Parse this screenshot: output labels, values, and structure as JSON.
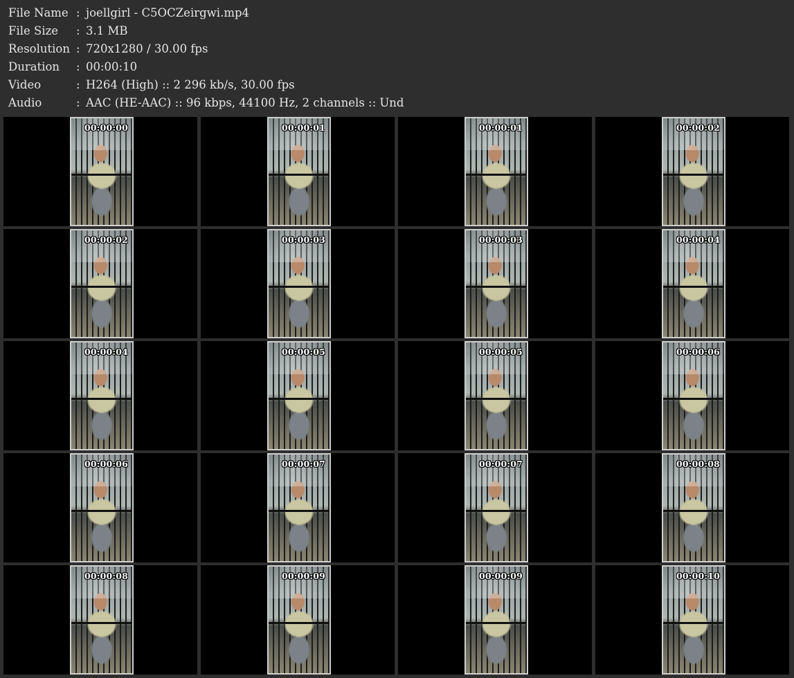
{
  "info": [
    {
      "label": "File Name",
      "sep": ":",
      "value": "joellgirl - C5OCZeirgwi.mp4"
    },
    {
      "label": "File Size",
      "sep": ":",
      "value": "3.1 MB"
    },
    {
      "label": "Resolution",
      "sep": ":",
      "value": "720x1280 / 30.00 fps"
    },
    {
      "label": "Duration",
      "sep": ":",
      "value": "00:00:10"
    },
    {
      "label": "Video",
      "sep": ":",
      "value": "H264 (High) :: 2 296 kb/s, 30.00 fps"
    },
    {
      "label": "Audio",
      "sep": ":",
      "value": "AAC (HE-AAC) :: 96 kbps, 44100 Hz, 2 channels :: Und"
    }
  ],
  "thumbnails": [
    {
      "time": "00:00:00"
    },
    {
      "time": "00:00:01"
    },
    {
      "time": "00:00:01"
    },
    {
      "time": "00:00:02"
    },
    {
      "time": "00:00:02"
    },
    {
      "time": "00:00:03"
    },
    {
      "time": "00:00:03"
    },
    {
      "time": "00:00:04"
    },
    {
      "time": "00:00:04"
    },
    {
      "time": "00:00:05"
    },
    {
      "time": "00:00:05"
    },
    {
      "time": "00:00:06"
    },
    {
      "time": "00:00:06"
    },
    {
      "time": "00:00:07"
    },
    {
      "time": "00:00:07"
    },
    {
      "time": "00:00:08"
    },
    {
      "time": "00:00:08"
    },
    {
      "time": "00:00:09"
    },
    {
      "time": "00:00:09"
    },
    {
      "time": "00:00:10"
    }
  ]
}
